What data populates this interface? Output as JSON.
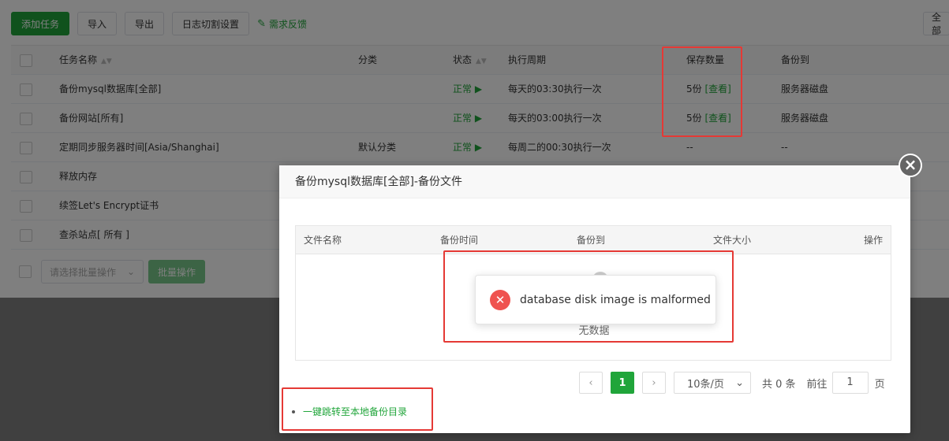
{
  "toolbar": {
    "add_task": "添加任务",
    "import": "导入",
    "export": "导出",
    "log_split": "日志切割设置",
    "feedback": "需求反馈",
    "all": "全部"
  },
  "table": {
    "headers": {
      "name": "任务名称",
      "category": "分类",
      "status": "状态",
      "cycle": "执行周期",
      "keep": "保存数量",
      "backup_to": "备份到"
    },
    "rows": [
      {
        "name": "备份mysql数据库[全部]",
        "category": "",
        "status": "正常",
        "cycle": "每天的03:30执行一次",
        "keep": "5份",
        "view": "[查看]",
        "backup_to": "服务器磁盘"
      },
      {
        "name": "备份网站[所有]",
        "category": "",
        "status": "正常",
        "cycle": "每天的03:00执行一次",
        "keep": "5份",
        "view": "[查看]",
        "backup_to": "服务器磁盘"
      },
      {
        "name": "定期同步服务器时间[Asia/Shanghai]",
        "category": "默认分类",
        "status": "正常",
        "cycle": "每周二的00:30执行一次",
        "keep": "--",
        "view": "",
        "backup_to": "--"
      },
      {
        "name": "释放内存"
      },
      {
        "name": "续签Let's Encrypt证书"
      },
      {
        "name": "查杀站点[ 所有 ]"
      }
    ],
    "status_icon": "play-triangle-icon"
  },
  "batch": {
    "placeholder": "请选择批量操作",
    "button": "批量操作"
  },
  "modal": {
    "title": "备份mysql数据库[全部]-备份文件",
    "columns": {
      "file_name": "文件名称",
      "backup_time": "备份时间",
      "backup_to": "备份到",
      "file_size": "文件大小",
      "action": "操作"
    },
    "empty": "无数据",
    "pagination": {
      "current": "1",
      "page_size": "10条/页",
      "total": "共 0 条",
      "goto": "前往",
      "goto_value": "1",
      "page_unit": "页"
    },
    "local_link": "一键跳转至本地备份目录"
  },
  "toast": {
    "message": "database disk image is malformed",
    "icon": "error-x-icon"
  },
  "colors": {
    "brand_green": "#20a53a",
    "error_red": "#ef5350",
    "highlight_red": "#e53935"
  }
}
